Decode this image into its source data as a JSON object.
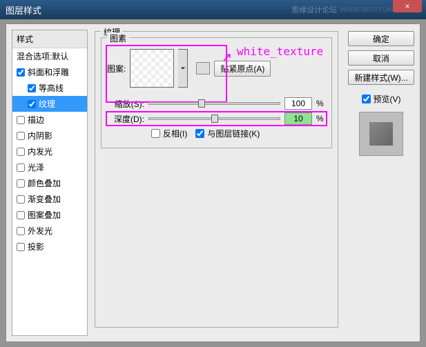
{
  "titlebar": {
    "title": "图层样式",
    "watermark": "思缘设计论坛",
    "url": "WWW.MISSYUAN.COM",
    "close": "×"
  },
  "left": {
    "header": "样式",
    "blend": "混合选项:默认",
    "items": [
      {
        "label": "斜面和浮雕",
        "checked": true,
        "sel": false,
        "sub": false
      },
      {
        "label": "等高线",
        "checked": true,
        "sel": false,
        "sub": true
      },
      {
        "label": "纹理",
        "checked": true,
        "sel": true,
        "sub": true
      },
      {
        "label": "描边",
        "checked": false,
        "sel": false,
        "sub": false
      },
      {
        "label": "内阴影",
        "checked": false,
        "sel": false,
        "sub": false
      },
      {
        "label": "内发光",
        "checked": false,
        "sel": false,
        "sub": false
      },
      {
        "label": "光泽",
        "checked": false,
        "sel": false,
        "sub": false
      },
      {
        "label": "颜色叠加",
        "checked": false,
        "sel": false,
        "sub": false
      },
      {
        "label": "渐变叠加",
        "checked": false,
        "sel": false,
        "sub": false
      },
      {
        "label": "图案叠加",
        "checked": false,
        "sel": false,
        "sub": false
      },
      {
        "label": "外发光",
        "checked": false,
        "sel": false,
        "sub": false
      },
      {
        "label": "投影",
        "checked": false,
        "sel": false,
        "sub": false
      }
    ]
  },
  "mid": {
    "section": "纹理",
    "group": "图素",
    "pattern_label": "图案:",
    "snap": "贴紧原点(A)",
    "scale_label": "缩放(S):",
    "scale_val": "100",
    "depth_label": "深度(D):",
    "depth_val": "10",
    "pct": "%",
    "invert": "反相(I)",
    "link": "与图层链接(K)",
    "annotation": "white_texture"
  },
  "right": {
    "ok": "确定",
    "cancel": "取消",
    "newstyle": "新建样式(W)...",
    "preview": "预览(V)"
  }
}
